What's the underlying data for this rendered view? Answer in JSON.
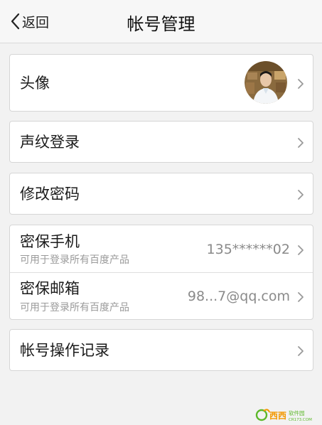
{
  "nav": {
    "back_label": "返回",
    "title": "帐号管理"
  },
  "rows": {
    "avatar": {
      "label": "头像"
    },
    "voiceprint": {
      "label": "声纹登录"
    },
    "change_password": {
      "label": "修改密码"
    },
    "security_phone": {
      "label": "密保手机",
      "sublabel": "可用于登录所有百度产品",
      "value": "135******02"
    },
    "security_email": {
      "label": "密保邮箱",
      "sublabel": "可用于登录所有百度产品",
      "value": "98...7@qq.com"
    },
    "account_log": {
      "label": "帐号操作记录"
    }
  },
  "watermark": {
    "brand": "西西",
    "tag": "软件园",
    "url": "CR173.COM"
  },
  "icons": {
    "back": "chevron-left-icon",
    "row_arrow": "chevron-right-icon"
  },
  "colors": {
    "background": "#f2f2f2",
    "card": "#ffffff",
    "label": "#1a1a1a",
    "sublabel": "#9a9a9a",
    "value": "#8a8a8a",
    "watermark_green": "#5cb82a",
    "watermark_orange": "#f39800"
  }
}
